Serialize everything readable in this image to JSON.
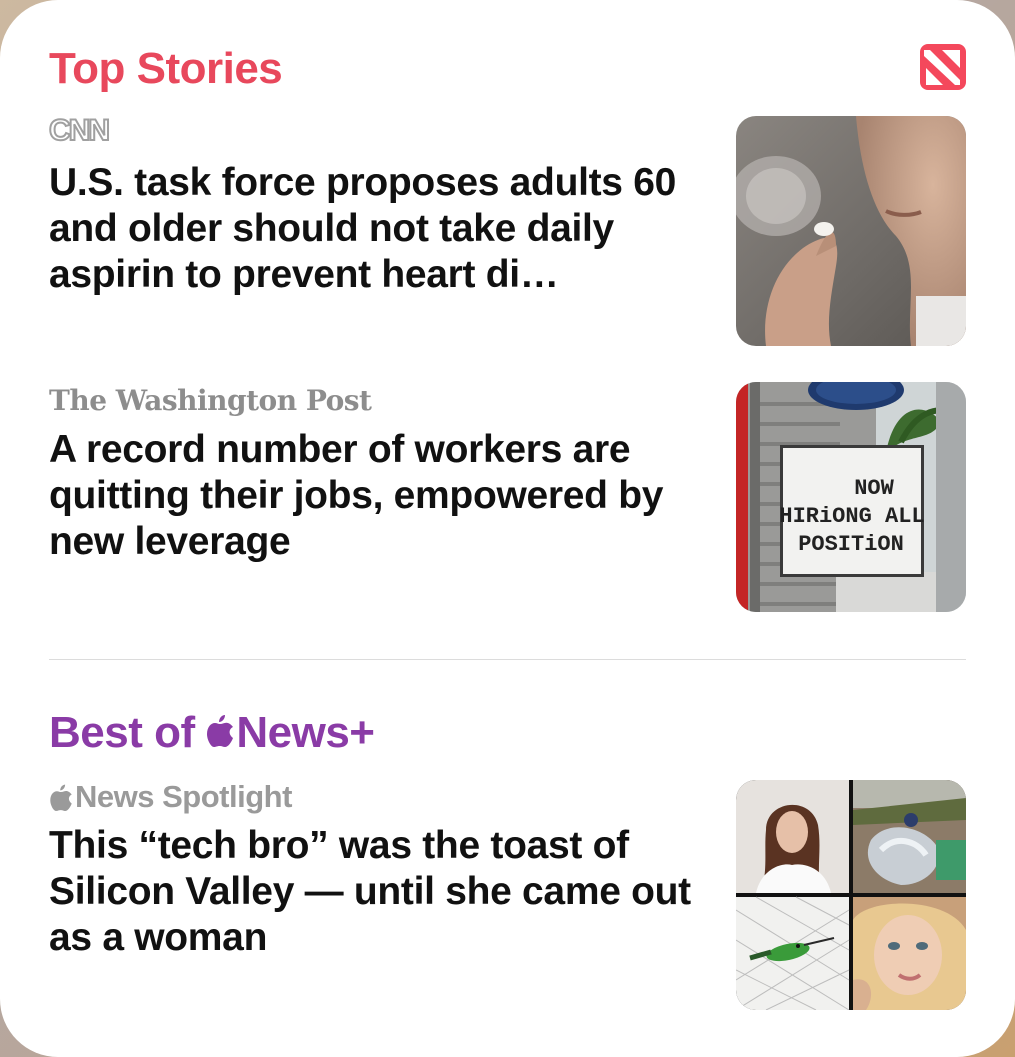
{
  "widget": {
    "top_stories_title": "Top Stories",
    "best_of_label_prefix": "Best of ",
    "best_of_label_suffix": "News+",
    "accent_red": "#e8485c",
    "accent_purple": "#8a3ba6",
    "app_icon": "apple-news-icon"
  },
  "stories": [
    {
      "publisher": "CNN",
      "headline": "U.S. task force proposes adults 60 and older should not take daily aspirin to prevent heart di…",
      "thumbnail": "photo-hand-holding-pill"
    },
    {
      "publisher": "The Washington Post",
      "headline": "A record number of workers are quitting their jobs, empowered by new leverage",
      "thumbnail": "photo-now-hiring-sign",
      "sign_text": [
        "NOW",
        "HIRiONG ALL",
        "POSITiON"
      ]
    },
    {
      "publisher_suffix": "News Spotlight",
      "headline": "This “tech bro” was the toast of Silicon Valley — until she came out as a woman",
      "thumbnail": "photo-collage-four"
    }
  ]
}
